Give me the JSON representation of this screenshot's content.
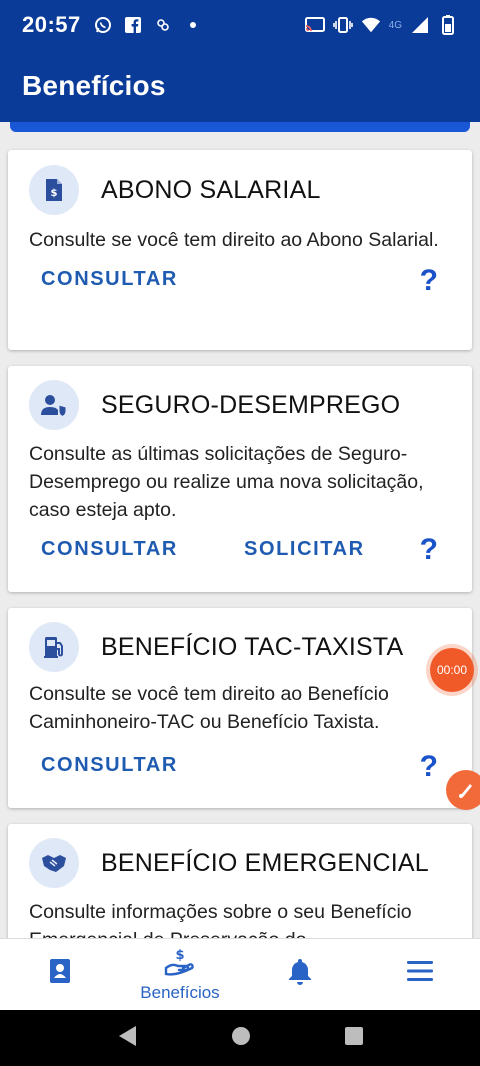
{
  "status_bar": {
    "time": "20:57",
    "network_label": "4G"
  },
  "app_bar": {
    "title": "Benefícios"
  },
  "cards": [
    {
      "title": "ABONO SALARIAL",
      "description": "Consulte se você tem direito ao Abono Salarial.",
      "actions": [
        "CONSULTAR"
      ],
      "help": "?",
      "icon": "document-money-icon"
    },
    {
      "title": "SEGURO-DESEMPREGO",
      "description": "Consulte as últimas solicitações de Seguro-Desemprego ou realize uma nova solicitação, caso esteja apto.",
      "actions": [
        "CONSULTAR",
        "SOLICITAR"
      ],
      "help": "?",
      "icon": "person-shield-icon"
    },
    {
      "title": "BENEFÍCIO TAC-TAXISTA",
      "description": "Consulte se você tem direito ao Benefício Caminhoneiro-TAC ou Benefício Taxista.",
      "actions": [
        "CONSULTAR"
      ],
      "help": "?",
      "icon": "fuel-pump-icon"
    },
    {
      "title": "BENEFÍCIO EMERGENCIAL",
      "description": "Consulte informações sobre o seu Benefício Emergencial de Preservação do",
      "actions": [],
      "icon": "handshake-icon"
    }
  ],
  "recorder": {
    "timer": "00:00"
  },
  "bottom_nav": {
    "items": [
      {
        "label": "",
        "icon": "id-card-icon"
      },
      {
        "label": "Benefícios",
        "icon": "hand-money-icon"
      },
      {
        "label": "",
        "icon": "bell-icon"
      },
      {
        "label": "",
        "icon": "menu-icon"
      }
    ]
  },
  "colors": {
    "primary": "#0b3b98",
    "accent": "#1f5bb0",
    "recorder": "#f05a28"
  }
}
